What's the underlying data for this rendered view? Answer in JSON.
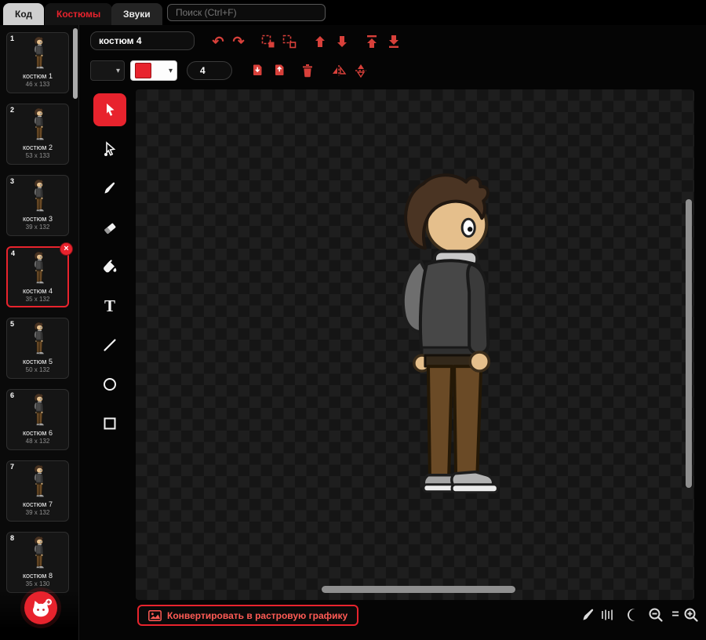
{
  "colors": {
    "accent": "#e8232d",
    "icon": "#d8403a"
  },
  "tabs": {
    "code": "Код",
    "costumes": "Костюмы",
    "sounds": "Звуки"
  },
  "search": {
    "placeholder": "Поиск (Ctrl+F)"
  },
  "icons": {
    "undo": "↶",
    "redo": "↷",
    "caret": "▾",
    "equals": "=",
    "text_tool": "T",
    "delete_x": "×"
  },
  "costume_list": {
    "items": [
      {
        "number": "1",
        "name": "костюм 1",
        "size": "46 x 133",
        "selected": false
      },
      {
        "number": "2",
        "name": "костюм 2",
        "size": "53 x 133",
        "selected": false
      },
      {
        "number": "3",
        "name": "костюм 3",
        "size": "39 x 132",
        "selected": false
      },
      {
        "number": "4",
        "name": "костюм 4",
        "size": "35 x 132",
        "selected": true
      },
      {
        "number": "5",
        "name": "костюм 5",
        "size": "50 x 132",
        "selected": false
      },
      {
        "number": "6",
        "name": "костюм 6",
        "size": "48 x 132",
        "selected": false
      },
      {
        "number": "7",
        "name": "костюм 7",
        "size": "39 x 132",
        "selected": false
      },
      {
        "number": "8",
        "name": "костюм 8",
        "size": "35 x 130",
        "selected": false
      }
    ]
  },
  "paint": {
    "costume_name_value": "костюм 4",
    "stroke_width_value": "4",
    "convert_button_label": "Конвертировать в растровую графику"
  }
}
